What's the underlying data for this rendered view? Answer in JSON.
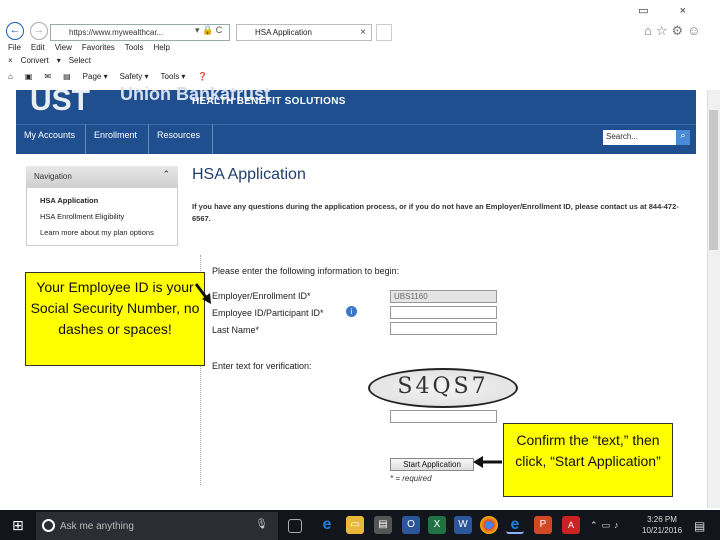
{
  "browser": {
    "address": "https://www.mywealthcar...",
    "address_controls": "▾ 🔒 C",
    "tab_title": "HSA Application",
    "tab_close": "×",
    "window_controls": "▭ ×",
    "menu": [
      "File",
      "Edit",
      "View",
      "Favorites",
      "Tools",
      "Help"
    ],
    "cmd": [
      "Convert",
      "Select"
    ],
    "toolbar": [
      "Page ▾",
      "Safety ▾",
      "Tools ▾"
    ]
  },
  "site": {
    "brand_big": "UST",
    "brand_word": "Union Bankatrust",
    "brand_sub": "HEALTH BENEFIT SOLUTIONS",
    "nav": [
      "My Accounts",
      "Enrollment",
      "Resources"
    ],
    "search_placeholder": "Search..."
  },
  "sidebar": {
    "heading": "Navigation",
    "links": [
      "HSA Application",
      "HSA Enrollment Eligibility",
      "Learn more about my plan options"
    ]
  },
  "main": {
    "title": "HSA Application",
    "info": "If you have any questions during the application process, or if you do not have an Employer/Enrollment ID, please contact us at 844-472-6567.",
    "form_heading": "Please enter the following information to begin:",
    "fields": [
      {
        "label": "Employer/Enrollment ID*",
        "value": "UBS1160"
      },
      {
        "label": "Employee ID/Participant ID*",
        "value": ""
      },
      {
        "label": "Last Name*",
        "value": ""
      }
    ],
    "verify_label": "Enter text for verification:",
    "captcha_text": "S4QS7",
    "start_button": "Start Application",
    "required_note": "* = required"
  },
  "callouts": {
    "employee_id": "Your Employee ID is your Social Security Number, no dashes or spaces!",
    "confirm": "Confirm the “text,” then click, “Start Application”"
  },
  "taskbar": {
    "search_placeholder": "Ask me anything",
    "time": "3:26 PM",
    "date": "10/21/2016"
  }
}
